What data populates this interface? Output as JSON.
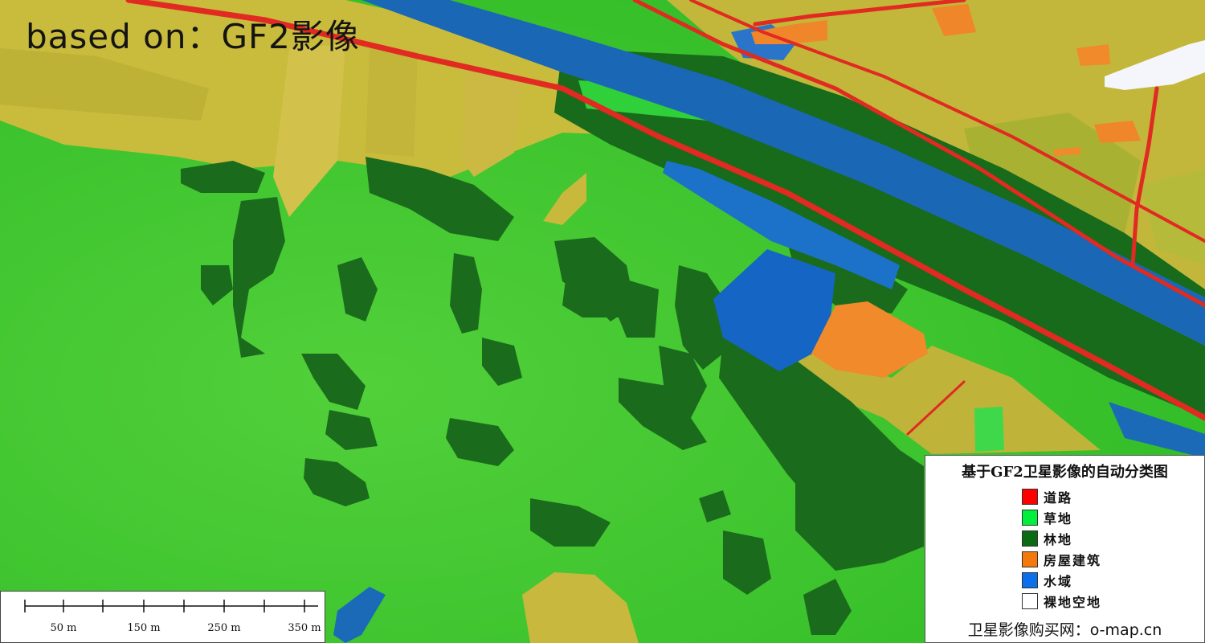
{
  "heading": "based on：GF2影像",
  "colors": {
    "road": "#e8231e",
    "grass": "#29e84a",
    "forest": "#145f16",
    "building": "#f47e1e",
    "water": "#1578e6",
    "bare": "#ffffff",
    "farmland": "#c3b43a"
  },
  "scale_bar": {
    "labels": [
      "50 m",
      "150 m",
      "250 m",
      "350 m"
    ]
  },
  "legend": {
    "title": "基于GF2卫星影像的自动分类图",
    "items": [
      {
        "label": "道路",
        "color": "#ff0000"
      },
      {
        "label": "草地",
        "color": "#00ef3c"
      },
      {
        "label": "林地",
        "color": "#0c6a12"
      },
      {
        "label": "房屋建筑",
        "color": "#f5780a"
      },
      {
        "label": "水域",
        "color": "#0a6fe8"
      },
      {
        "label": "裸地空地",
        "color": "#ffffff"
      }
    ],
    "footer": "卫星影像购买网：o-map.cn"
  }
}
